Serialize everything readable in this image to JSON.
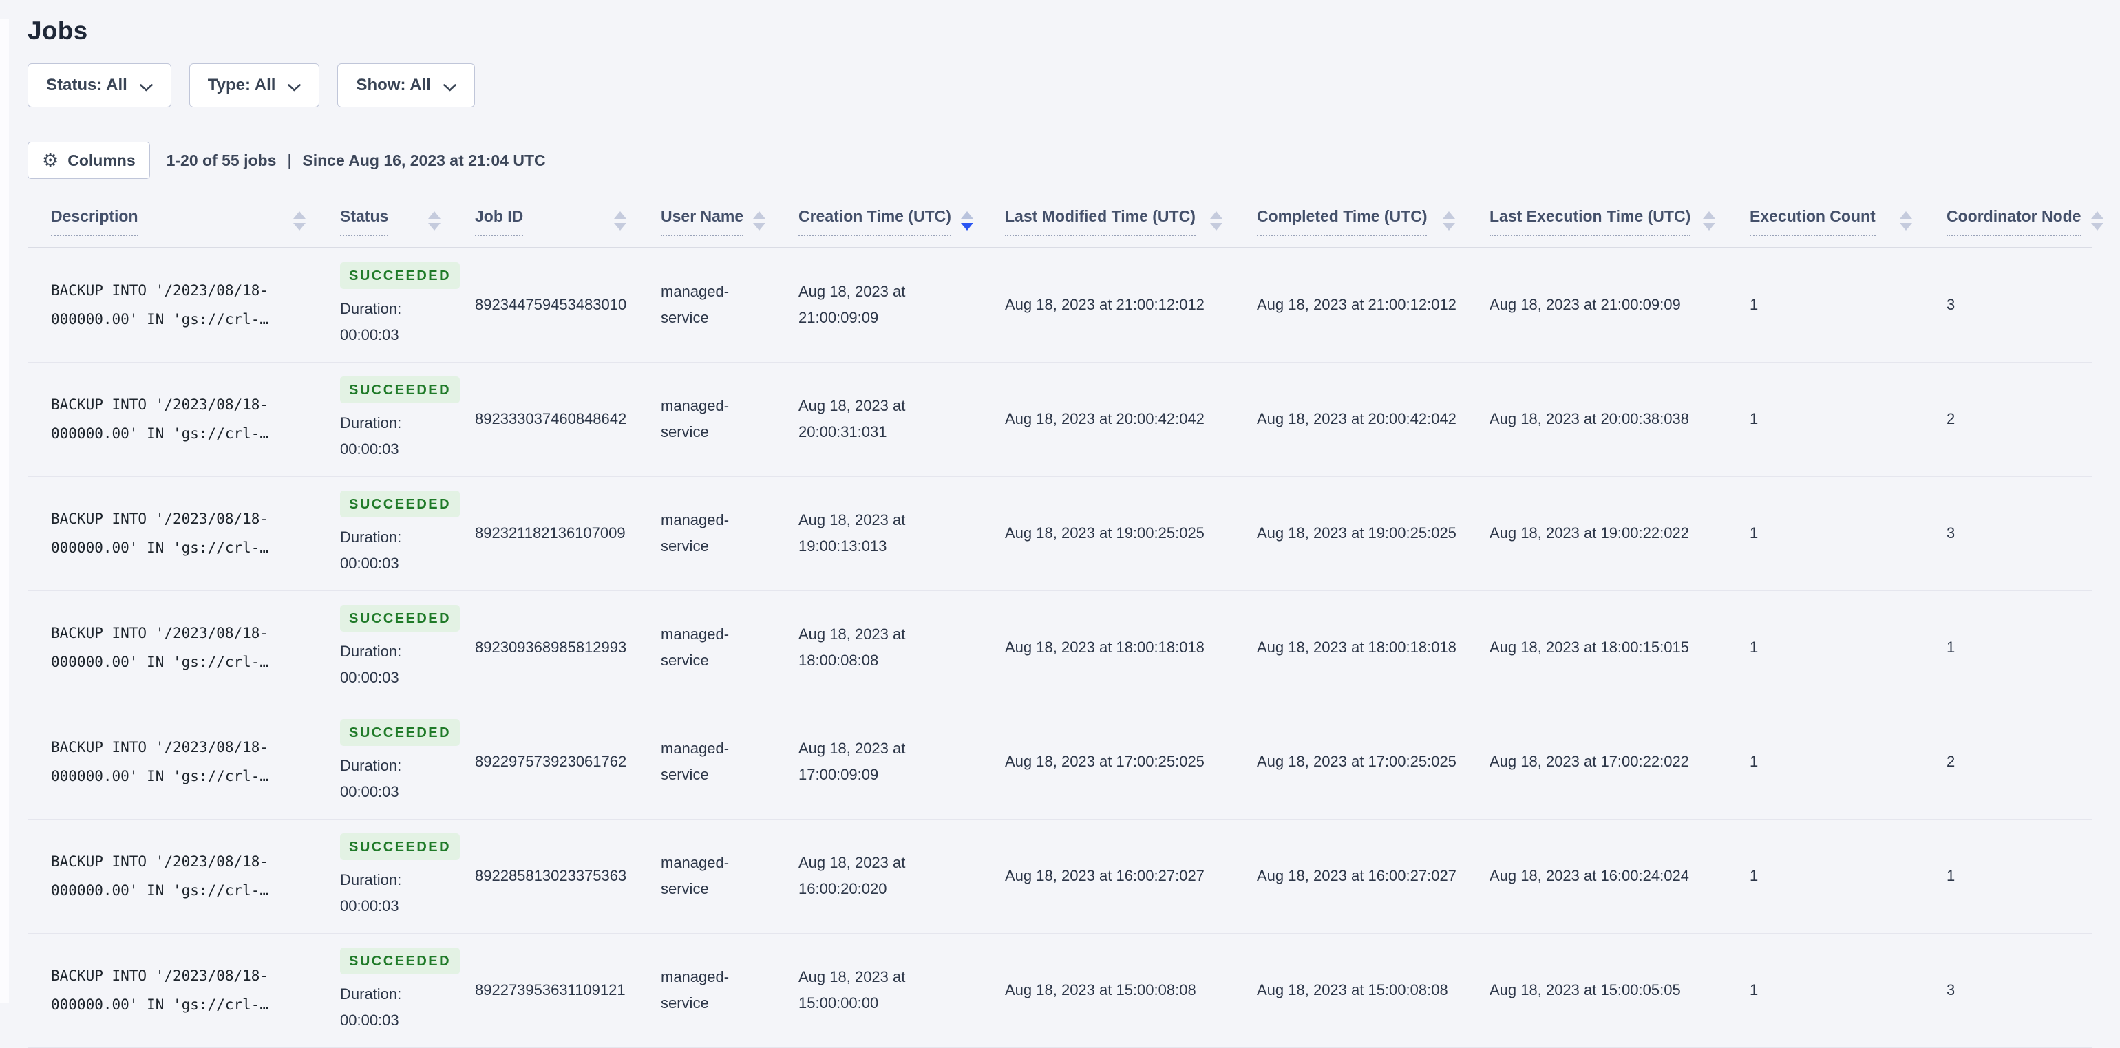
{
  "page": {
    "title": "Jobs"
  },
  "colors": {
    "background": "#f4f5f9",
    "accent_sort_blue": "#2a55f2",
    "badge_bg": "#e3f2e4",
    "badge_text": "#1f7a28",
    "border_grey": "#c0c6d9"
  },
  "icons": {
    "gear": "⚙"
  },
  "filters": [
    {
      "label": "Status: All"
    },
    {
      "label": "Type: All"
    },
    {
      "label": "Show: All"
    }
  ],
  "toolbar": {
    "columns_label": "Columns",
    "results_summary": "1-20 of 55 jobs",
    "separator": "|",
    "since_text": "Since Aug 16, 2023 at 21:04 UTC"
  },
  "table": {
    "columns": [
      {
        "label": "Description",
        "sort": "none"
      },
      {
        "label": "Status",
        "sort": "none"
      },
      {
        "label": "Job ID",
        "sort": "none"
      },
      {
        "label": "User Name",
        "sort": "none"
      },
      {
        "label": "Creation Time (UTC)",
        "sort": "desc"
      },
      {
        "label": "Last Modified Time (UTC)",
        "sort": "none"
      },
      {
        "label": "Completed Time (UTC)",
        "sort": "none"
      },
      {
        "label": "Last Execution Time (UTC)",
        "sort": "none"
      },
      {
        "label": "Execution Count",
        "sort": "none"
      },
      {
        "label": "Coordinator Node",
        "sort": "none"
      }
    ],
    "rows": [
      {
        "description": "BACKUP INTO '/2023/08/18-000000.00' IN 'gs://crl-…",
        "status": "SUCCEEDED",
        "duration_text": "Duration: 00:00:03",
        "job_id": "892344759453483010",
        "user_name": "managed-service",
        "creation_time": "Aug 18, 2023 at 21:00:09:09",
        "last_modified_time": "Aug 18, 2023 at 21:00:12:012",
        "completed_time": "Aug 18, 2023 at 21:00:12:012",
        "last_execution_time": "Aug 18, 2023 at 21:00:09:09",
        "execution_count": "1",
        "coordinator_node": "3"
      },
      {
        "description": "BACKUP INTO '/2023/08/18-000000.00' IN 'gs://crl-…",
        "status": "SUCCEEDED",
        "duration_text": "Duration: 00:00:03",
        "job_id": "892333037460848642",
        "user_name": "managed-service",
        "creation_time": "Aug 18, 2023 at 20:00:31:031",
        "last_modified_time": "Aug 18, 2023 at 20:00:42:042",
        "completed_time": "Aug 18, 2023 at 20:00:42:042",
        "last_execution_time": "Aug 18, 2023 at 20:00:38:038",
        "execution_count": "1",
        "coordinator_node": "2"
      },
      {
        "description": "BACKUP INTO '/2023/08/18-000000.00' IN 'gs://crl-…",
        "status": "SUCCEEDED",
        "duration_text": "Duration: 00:00:03",
        "job_id": "892321182136107009",
        "user_name": "managed-service",
        "creation_time": "Aug 18, 2023 at 19:00:13:013",
        "last_modified_time": "Aug 18, 2023 at 19:00:25:025",
        "completed_time": "Aug 18, 2023 at 19:00:25:025",
        "last_execution_time": "Aug 18, 2023 at 19:00:22:022",
        "execution_count": "1",
        "coordinator_node": "3"
      },
      {
        "description": "BACKUP INTO '/2023/08/18-000000.00' IN 'gs://crl-…",
        "status": "SUCCEEDED",
        "duration_text": "Duration: 00:00:03",
        "job_id": "892309368985812993",
        "user_name": "managed-service",
        "creation_time": "Aug 18, 2023 at 18:00:08:08",
        "last_modified_time": "Aug 18, 2023 at 18:00:18:018",
        "completed_time": "Aug 18, 2023 at 18:00:18:018",
        "last_execution_time": "Aug 18, 2023 at 18:00:15:015",
        "execution_count": "1",
        "coordinator_node": "1"
      },
      {
        "description": "BACKUP INTO '/2023/08/18-000000.00' IN 'gs://crl-…",
        "status": "SUCCEEDED",
        "duration_text": "Duration: 00:00:03",
        "job_id": "892297573923061762",
        "user_name": "managed-service",
        "creation_time": "Aug 18, 2023 at 17:00:09:09",
        "last_modified_time": "Aug 18, 2023 at 17:00:25:025",
        "completed_time": "Aug 18, 2023 at 17:00:25:025",
        "last_execution_time": "Aug 18, 2023 at 17:00:22:022",
        "execution_count": "1",
        "coordinator_node": "2"
      },
      {
        "description": "BACKUP INTO '/2023/08/18-000000.00' IN 'gs://crl-…",
        "status": "SUCCEEDED",
        "duration_text": "Duration: 00:00:03",
        "job_id": "892285813023375363",
        "user_name": "managed-service",
        "creation_time": "Aug 18, 2023 at 16:00:20:020",
        "last_modified_time": "Aug 18, 2023 at 16:00:27:027",
        "completed_time": "Aug 18, 2023 at 16:00:27:027",
        "last_execution_time": "Aug 18, 2023 at 16:00:24:024",
        "execution_count": "1",
        "coordinator_node": "1"
      },
      {
        "description": "BACKUP INTO '/2023/08/18-000000.00' IN 'gs://crl-…",
        "status": "SUCCEEDED",
        "duration_text": "Duration: 00:00:03",
        "job_id": "892273953631109121",
        "user_name": "managed-service",
        "creation_time": "Aug 18, 2023 at 15:00:00:00",
        "last_modified_time": "Aug 18, 2023 at 15:00:08:08",
        "completed_time": "Aug 18, 2023 at 15:00:08:08",
        "last_execution_time": "Aug 18, 2023 at 15:00:05:05",
        "execution_count": "1",
        "coordinator_node": "3"
      }
    ]
  }
}
